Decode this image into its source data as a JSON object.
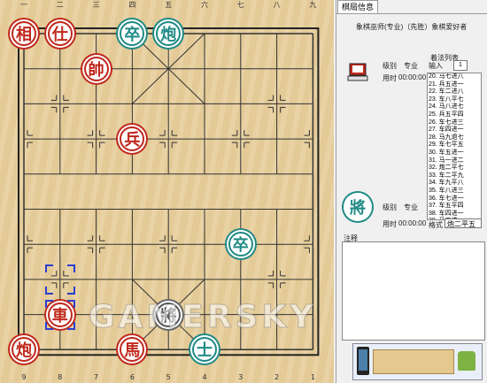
{
  "board": {
    "top_numbers": [
      "一",
      "二",
      "三",
      "四",
      "五",
      "六",
      "七",
      "八",
      "九"
    ],
    "bottom_numbers": [
      "9",
      "8",
      "7",
      "6",
      "5",
      "4",
      "3",
      "2",
      "1"
    ]
  },
  "pieces": [
    {
      "char": "相",
      "side": "red",
      "col": 0,
      "row": 0,
      "name": "red-elephant-piece"
    },
    {
      "char": "仕",
      "side": "red",
      "col": 1,
      "row": 0,
      "name": "red-advisor-piece"
    },
    {
      "char": "卒",
      "side": "green",
      "col": 3,
      "row": 0,
      "name": "green-pawn-piece"
    },
    {
      "char": "炮",
      "side": "green",
      "col": 4,
      "row": 0,
      "name": "green-cannon-piece"
    },
    {
      "char": "帥",
      "side": "red",
      "col": 2,
      "row": 1,
      "name": "red-king-piece"
    },
    {
      "char": "兵",
      "side": "red",
      "col": 3,
      "row": 3,
      "name": "red-pawn-piece"
    },
    {
      "char": "卒",
      "side": "green",
      "col": 6,
      "row": 6,
      "name": "green-pawn-piece-2"
    },
    {
      "char": "車",
      "side": "red",
      "col": 1,
      "row": 8,
      "name": "red-chariot-piece"
    },
    {
      "char": "將",
      "side": "gray",
      "col": 4,
      "row": 8,
      "name": "gray-general-piece"
    },
    {
      "char": "炮",
      "side": "red",
      "col": 0,
      "row": 9,
      "name": "red-cannon-piece"
    },
    {
      "char": "馬",
      "side": "red",
      "col": 3,
      "row": 9,
      "name": "red-horse-piece"
    },
    {
      "char": "士",
      "side": "green",
      "col": 5,
      "row": 9,
      "name": "green-advisor-piece"
    }
  ],
  "panel": {
    "tab_label": "棋局信息",
    "title": "象棋巫师(专业)（先胜）象棋爱好者",
    "top_player": {
      "level_label": "级别",
      "level": "专业",
      "time_label": "用时",
      "time": "00:00:00"
    },
    "bottom_player": {
      "level_label": "级别",
      "level": "专业",
      "time_label": "用时",
      "time": "00:00:00"
    },
    "moves_header": "着法列表",
    "input_label": "输入",
    "input_value": "1",
    "moves": [
      "20. 马七进八",
      "21. 兵五进一",
      "22. 车二进八",
      "23. 车八平七",
      "24. 马八进七",
      "25. 兵五平四",
      "26. 车七进三",
      "27. 车四进一",
      "28. 马九退七",
      "29. 车七平五",
      "30. 车五进一",
      "31. 马一进二",
      "32. 炮二平七",
      "33. 车二平九",
      "34. 车九平八",
      "35. 车八进三",
      "36. 车七进一",
      "37. 车五平四",
      "38. 车四进一",
      "39. 马二进一",
      "40. 兵四平五",
      "41. 车四平五",
      "42. 马一进三",
      "43. 车五进一",
      "44. 马二进一"
    ],
    "format_label": "格式",
    "format_value": "炮二平五",
    "notes_label": "注释"
  },
  "watermark": "GAMERSKY"
}
